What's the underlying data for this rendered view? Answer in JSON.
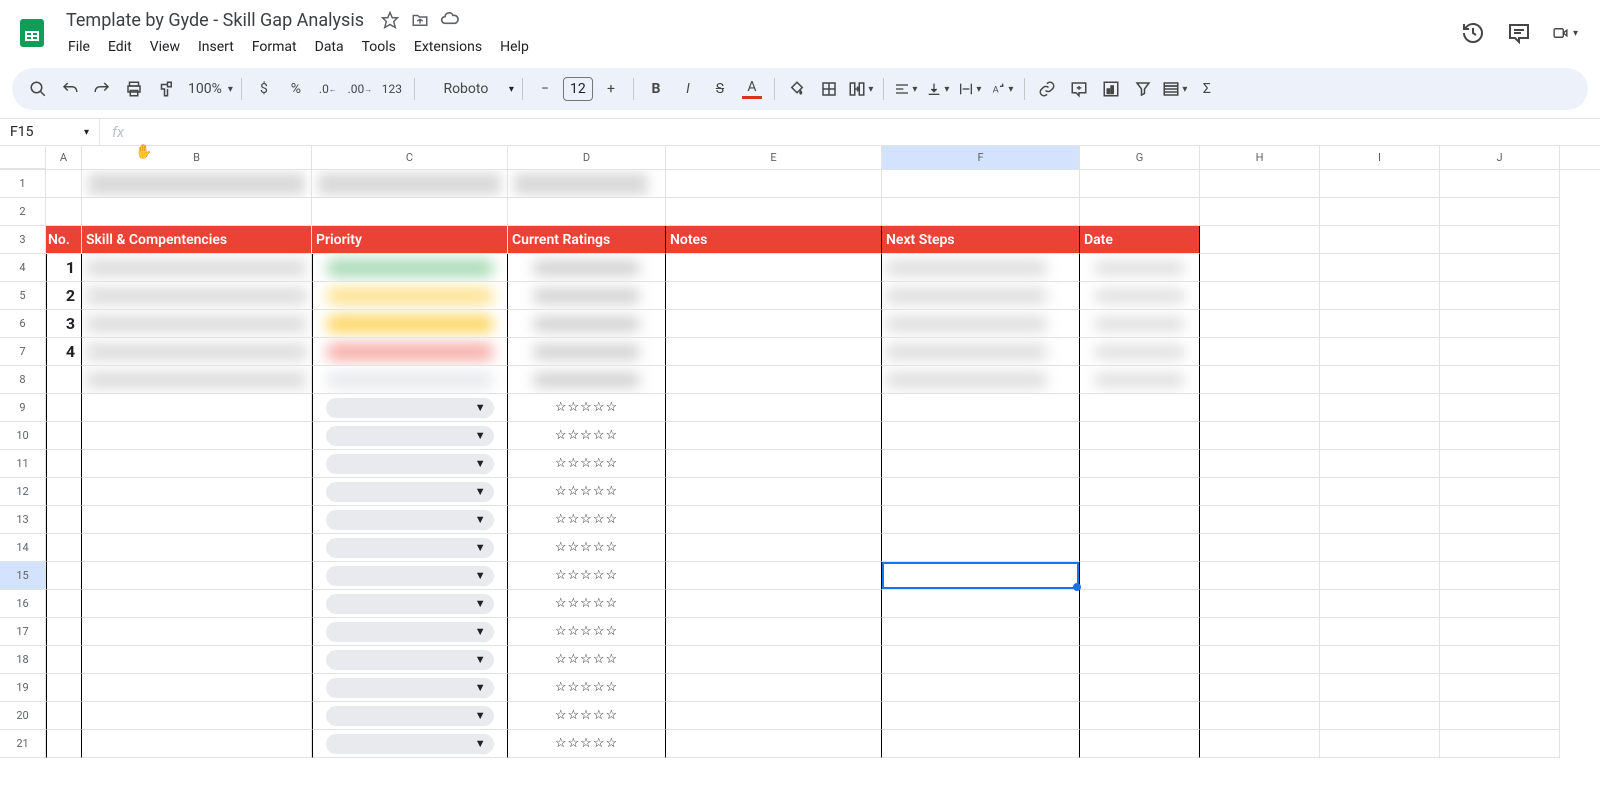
{
  "doc": {
    "title": "Template by Gyde - Skill Gap Analysis"
  },
  "menus": [
    "File",
    "Edit",
    "View",
    "Insert",
    "Format",
    "Data",
    "Tools",
    "Extensions",
    "Help"
  ],
  "toolbar": {
    "zoom": "100%",
    "font": "Roboto",
    "font_size": "12"
  },
  "name_box": "F15",
  "columns": [
    "A",
    "B",
    "C",
    "D",
    "E",
    "F",
    "G",
    "H",
    "I",
    "J"
  ],
  "col_widths": {
    "A": 36,
    "B": 230,
    "C": 196,
    "D": 158,
    "E": 216,
    "F": 198,
    "G": 120,
    "H": 120,
    "I": 120,
    "J": 120
  },
  "selected_col": "F",
  "selected_row": 15,
  "header_row": {
    "no": "No.",
    "skill": "Skill & Compentencies",
    "priority": "Priority",
    "ratings": "Current Ratings",
    "notes": "Notes",
    "next": "Next Steps",
    "date": "Date"
  },
  "data_rows": [
    {
      "no": "1"
    },
    {
      "no": "2"
    },
    {
      "no": "3"
    },
    {
      "no": "4"
    }
  ],
  "empty_rows_start": 9,
  "empty_rows_end": 21,
  "star_empty": "☆☆☆☆☆",
  "row_count": 21
}
